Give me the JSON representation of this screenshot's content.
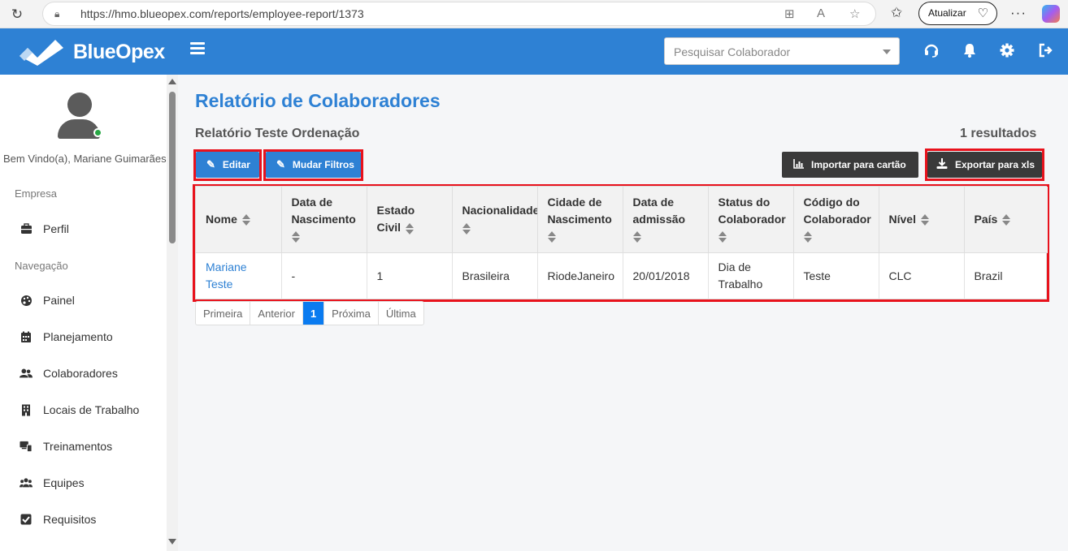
{
  "browser": {
    "url": "https://hmo.blueopex.com/reports/employee-report/1373",
    "update_label": "Atualizar"
  },
  "app": {
    "brand": "BlueOpex",
    "search_placeholder": "Pesquisar Colaborador",
    "accent": "#2e81d4"
  },
  "sidebar": {
    "welcome": "Bem Vindo(a), Mariane Guimarães",
    "section_company": "Empresa",
    "section_nav": "Navegação",
    "items": [
      {
        "label": "Perfil",
        "icon": "briefcase-icon"
      },
      {
        "label": "Painel",
        "icon": "palette-icon"
      },
      {
        "label": "Planejamento",
        "icon": "calendar-icon"
      },
      {
        "label": "Colaboradores",
        "icon": "users-icon"
      },
      {
        "label": "Locais de Trabalho",
        "icon": "building-icon"
      },
      {
        "label": "Treinamentos",
        "icon": "devices-icon"
      },
      {
        "label": "Equipes",
        "icon": "team-icon"
      },
      {
        "label": "Requisitos",
        "icon": "checkbox-icon"
      }
    ]
  },
  "main": {
    "title": "Relatório de Colaboradores",
    "report_name": "Relatório Teste Ordenação",
    "results": "1 resultados",
    "buttons": {
      "edit": "Editar",
      "change_filters": "Mudar Filtros",
      "import_card": "Importar para cartão",
      "export_xls": "Exportar para xls"
    },
    "table": {
      "headers": [
        "Nome",
        "Data de Nascimento",
        "Estado Civil",
        "Nacionalidade",
        "Cidade de Nascimento",
        "Data de admissão",
        "Status do Colaborador",
        "Código do Colaborador",
        "Nível",
        "País"
      ],
      "rows": [
        [
          "Mariane Teste",
          "-",
          "1",
          "Brasileira",
          "RiodeJaneiro",
          "20/01/2018",
          "Dia de Trabalho",
          "Teste",
          "CLC",
          "Brazil"
        ]
      ]
    },
    "pager": {
      "first": "Primeira",
      "prev": "Anterior",
      "current": "1",
      "next": "Próxima",
      "last": "Última"
    }
  }
}
